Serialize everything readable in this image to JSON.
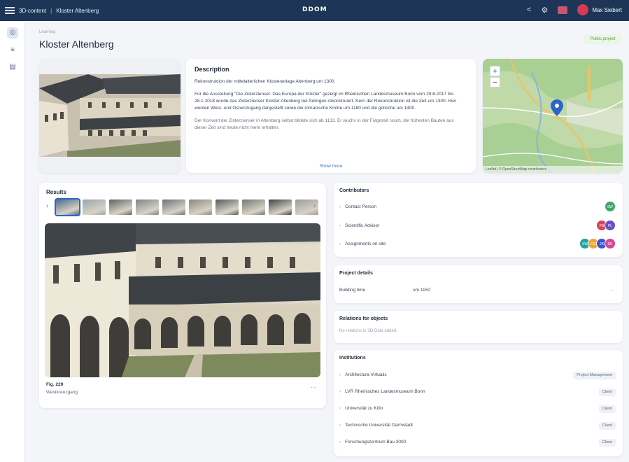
{
  "topbar": {
    "breadcrumb": [
      "3D-content",
      "Kloster Altenberg"
    ],
    "brand": "DDOM",
    "user_name": "Max Siebert"
  },
  "page": {
    "pre_title": "Learning",
    "title": "Kloster Altenberg",
    "status_badge": "Public project"
  },
  "description": {
    "heading": "Description",
    "paragraphs": [
      "Rekonstruktion der mittelalterlichen Klosteranlage Altenberg um 1300.",
      "Für die Ausstellung \"Die Zisterzienser. Das Europa der Klöster\" gezeigt im Rheinischen Landesmuseum Bonn vom 29.6.2017 bis 28.1.2018 wurde das Zisterzienser Kloster Altenberg bei Solingen rekonstruiert. Kern der Rekonstruktion ist die Zeit um 1300. Hier wurden West- und Ostumzugang dargestellt sowie die romanische Kirche um 1180 und die gotische um 1400.",
      "Der Konvent der Zisterzienser in Altenberg selbst bildete sich ab 1133. Er wuchs in der Folgezeit rasch, die frühesten Bauten aus dieser Zeit sind heute nicht mehr erhalten."
    ],
    "show_more": "Show more"
  },
  "map": {
    "attribution": "Leaflet | © OpenStreetMap contributors",
    "zoom_in": "+",
    "zoom_out": "−"
  },
  "results": {
    "heading": "Results",
    "thumb_colors": [
      "#4a6b8c",
      "#9aa6b0",
      "#5d6468",
      "#7d8589",
      "#6b7378",
      "#8a877c",
      "#565c60",
      "#727a72",
      "#3d4346",
      "#9a9c98"
    ],
    "caption_title": "Fig. 229",
    "caption_sub": "Westkreuzgang"
  },
  "contributors": {
    "heading": "Contributors",
    "rows": [
      {
        "label": "Contact Person",
        "avatars": [
          {
            "initials": "SW",
            "color": "#3ea86b"
          }
        ]
      },
      {
        "label": "Scientific Advisor",
        "avatars": [
          {
            "initials": "FB",
            "color": "#d6435b"
          },
          {
            "initials": "PL",
            "color": "#6a4fc7"
          }
        ]
      },
      {
        "label": "Assignments on site",
        "avatars": [
          {
            "initials": "SW",
            "color": "#1ea4a2"
          },
          {
            "initials": "CG",
            "color": "#f1a432"
          },
          {
            "initials": "JK",
            "color": "#3b55d6"
          },
          {
            "initials": "DK",
            "color": "#d64596"
          }
        ]
      }
    ]
  },
  "project_details": {
    "heading": "Project details",
    "key": "Building time",
    "value": "um 1150"
  },
  "related": {
    "heading": "Relations for objects",
    "empty_text": "No relations to 3D-Data added."
  },
  "institutions": {
    "heading": "Institutions",
    "rows": [
      {
        "label": "Architectura Virtualis",
        "tag": "Project Management"
      },
      {
        "label": "LVR Rheinisches Landesmuseum Bonn",
        "tag": "Client"
      },
      {
        "label": "Universität zu Köln",
        "tag": "Client"
      },
      {
        "label": "Technische Universität Darmstadt",
        "tag": "Client"
      },
      {
        "label": "Forschungszentrum Bau 3000",
        "tag": "Client"
      }
    ]
  }
}
